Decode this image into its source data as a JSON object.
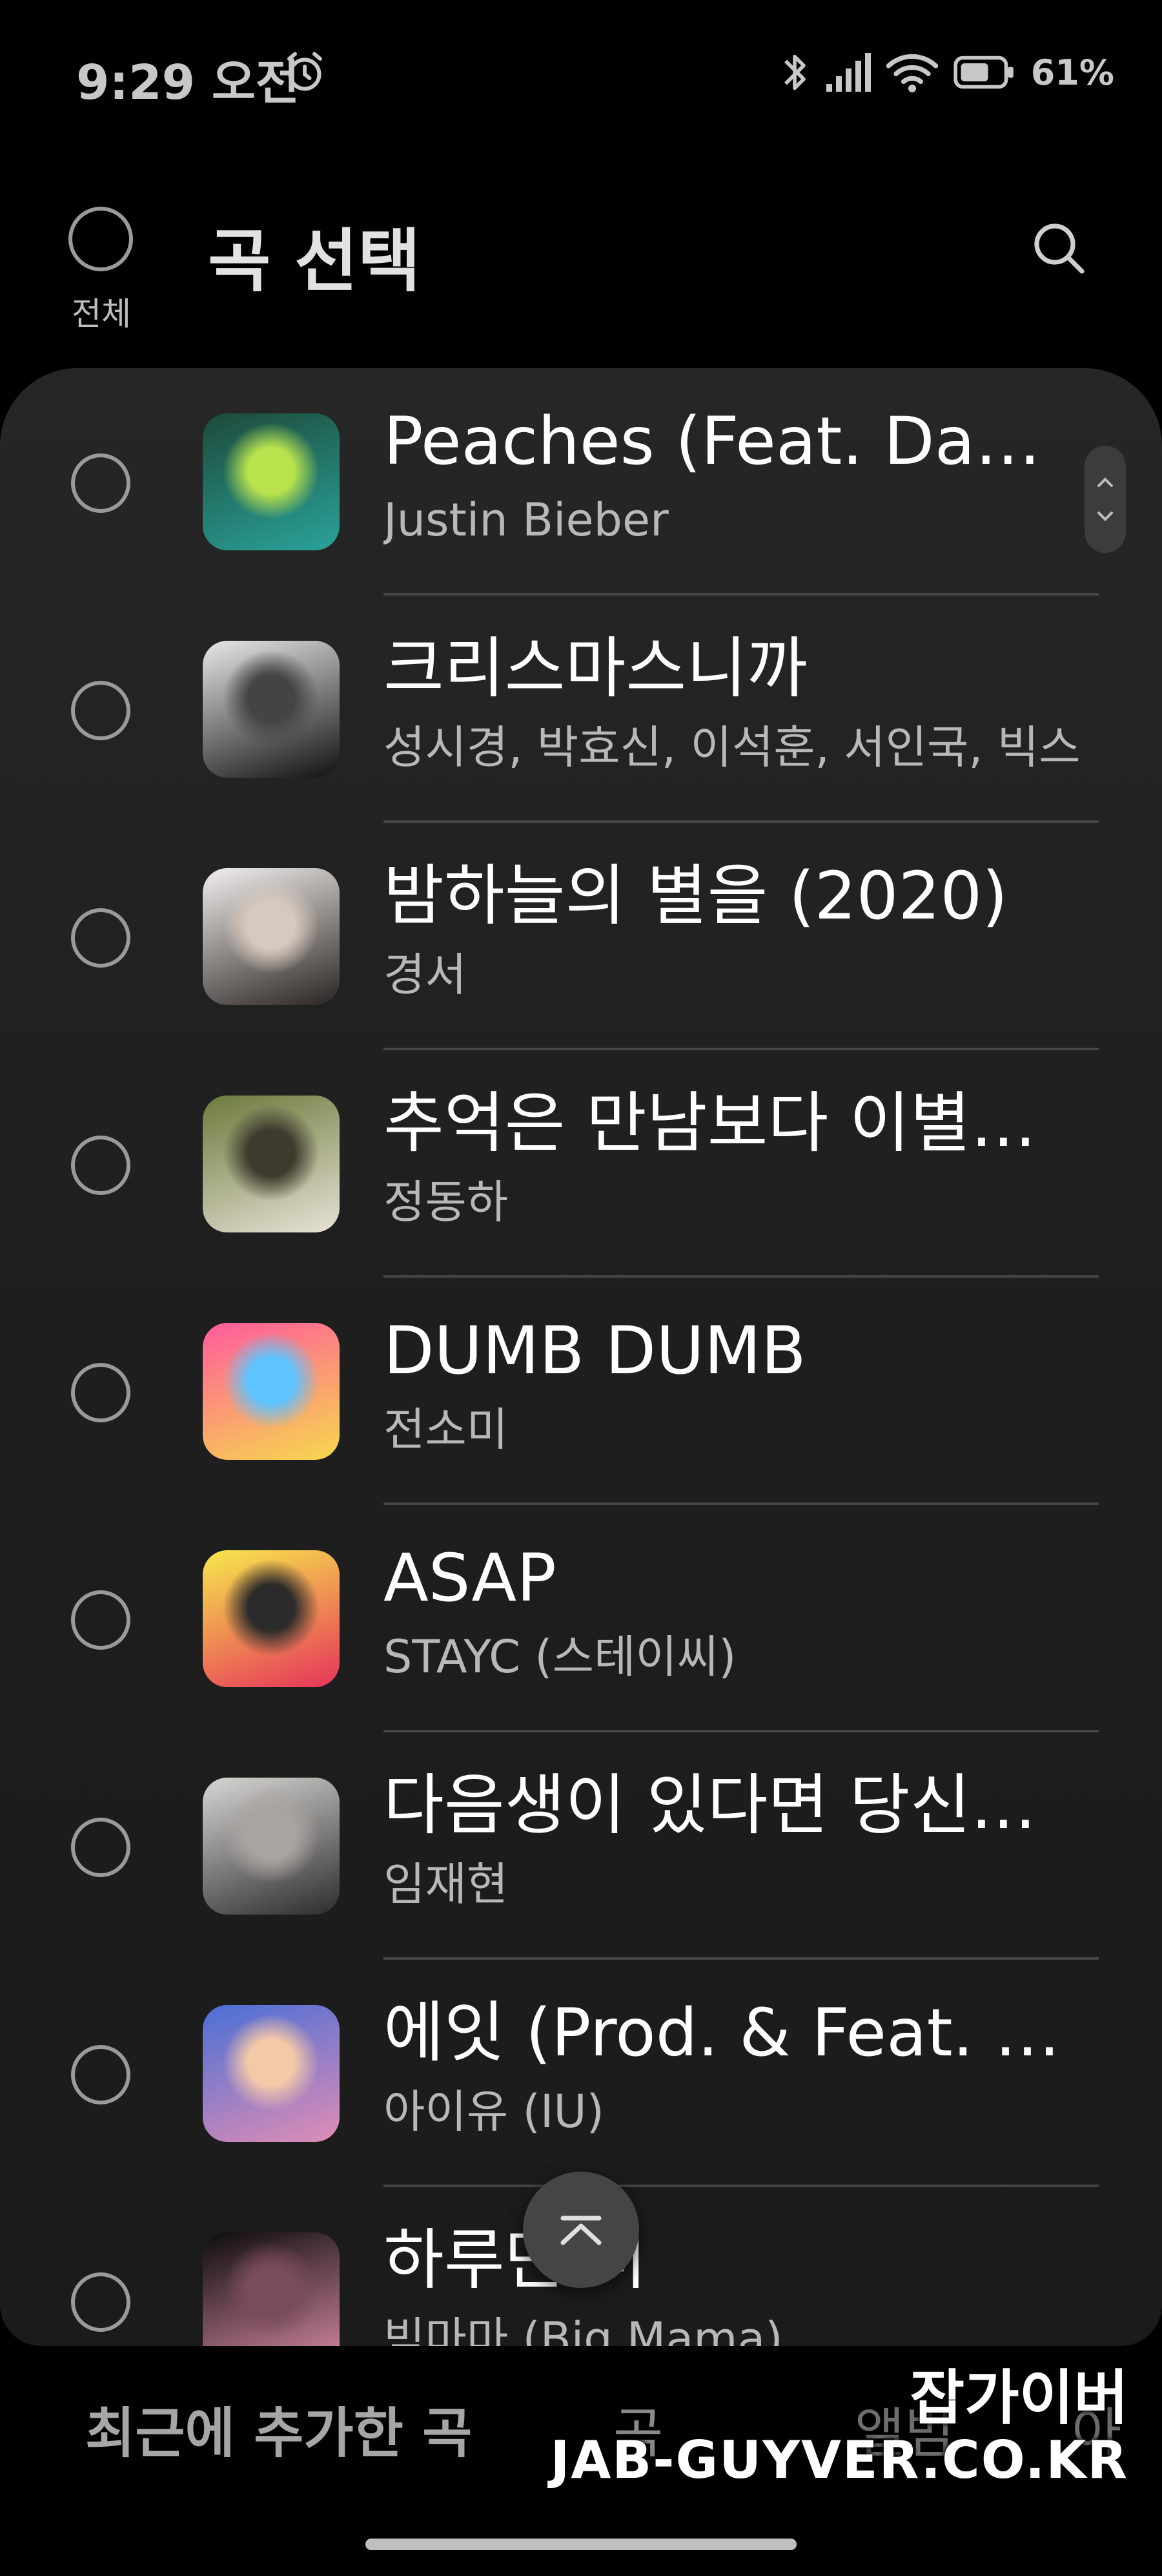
{
  "status_bar": {
    "time": "9:29 오전",
    "battery": "61%",
    "icons": [
      "alarm-icon",
      "bluetooth-icon",
      "signal-icon",
      "wifi-icon",
      "battery-icon"
    ]
  },
  "header": {
    "title": "곡 선택",
    "select_all_label": "전체",
    "icons": [
      "search-icon"
    ]
  },
  "songs": [
    {
      "title": "Peaches (Feat. Daniel Caesar & Giveon)",
      "artist": "Justin Bieber",
      "art_colors": [
        "#1d4a3a",
        "#2aa39a",
        "#b8e34c"
      ]
    },
    {
      "title": "크리스마스니까",
      "artist": "성시경, 박효신, 이석훈, 서인국, 빅스",
      "art_colors": [
        "#e8e8e8",
        "#111111",
        "#444444"
      ]
    },
    {
      "title": "밤하늘의 별을 (2020)",
      "artist": "경서",
      "art_colors": [
        "#f2f0ee",
        "#2a2422",
        "#d8c9be"
      ]
    },
    {
      "title": "추억은 만남보다 이별에 남아",
      "artist": "정동하",
      "art_colors": [
        "#6b7a3c",
        "#e8e2d6",
        "#3e3a2c"
      ]
    },
    {
      "title": "DUMB DUMB",
      "artist": "전소미",
      "art_colors": [
        "#ff5b9c",
        "#f7d84d",
        "#5fc3ff"
      ]
    },
    {
      "title": "ASAP",
      "artist": "STAYC (스테이씨)",
      "art_colors": [
        "#f7e84c",
        "#e6335a",
        "#2b2b2b"
      ]
    },
    {
      "title": "다음생이 있다면 당신을 다시",
      "artist": "임재현",
      "art_colors": [
        "#d9d7d4",
        "#2e2c2b",
        "#a9a6a2"
      ]
    },
    {
      "title": "에잇 (Prod. & Feat. SUGA of BTS)",
      "artist": "아이유 (IU)",
      "art_colors": [
        "#4a6fd6",
        "#e08db5",
        "#f4c9a8"
      ]
    },
    {
      "title": "하루만 더",
      "artist": "빅마마 (Big Mama)",
      "art_colors": [
        "#0c0c0c",
        "#d88aa6",
        "#7a4c5a"
      ]
    }
  ],
  "tabs": [
    "최근에 추가한 곡",
    "곡",
    "앨범",
    "아"
  ],
  "watermark": {
    "line1": "잡가이버",
    "line2": "JAB-GUYVER.CO.KR"
  }
}
